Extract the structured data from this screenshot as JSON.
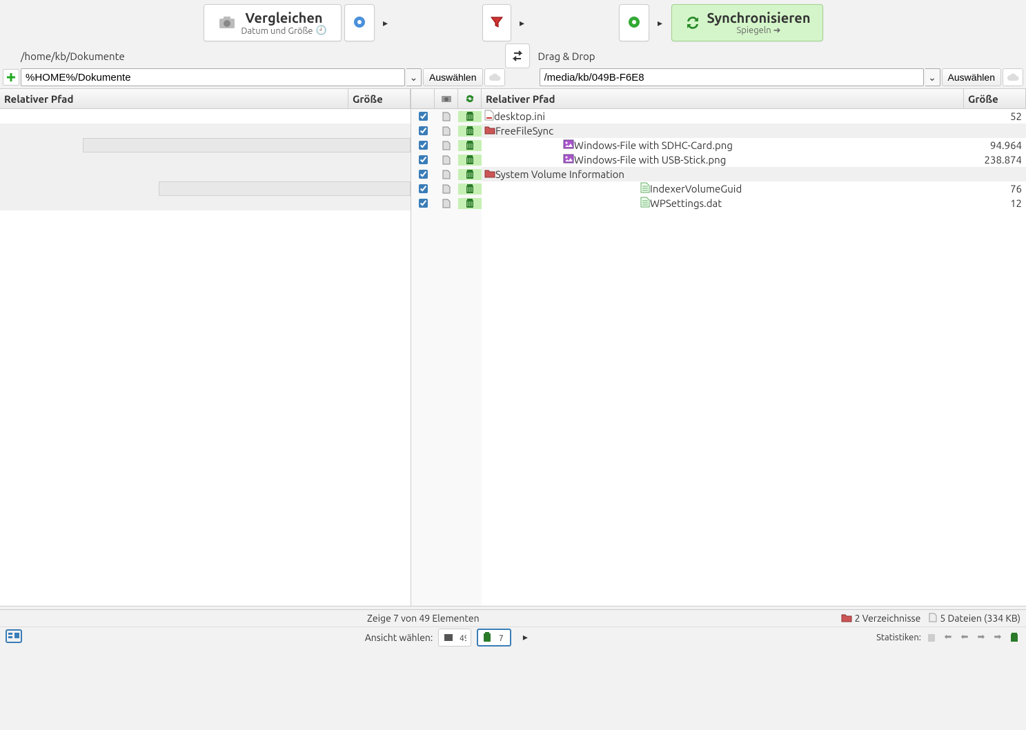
{
  "toolbar": {
    "compare": {
      "title": "Vergleichen",
      "subtitle": "Datum und Größe"
    },
    "sync": {
      "title": "Synchronisieren",
      "subtitle": "Spiegeln ➜"
    }
  },
  "paths": {
    "left_display": "/home/kb/Dokumente",
    "right_display": "Drag & Drop",
    "left_input": "%HOME%/Dokumente",
    "right_input": "/media/kb/049B-F6E8",
    "select_label": "Auswählen"
  },
  "headers": {
    "rel_path": "Relativer Pfad",
    "size": "Größe"
  },
  "right_rows": [
    {
      "type": "file",
      "indent": 0,
      "name": "desktop.ini",
      "size": "52",
      "icon": "file"
    },
    {
      "type": "folder",
      "indent": 0,
      "name": "FreeFileSync",
      "size": "",
      "icon": "folder"
    },
    {
      "type": "file",
      "indent": 1,
      "name": "Windows-File with SDHC-Card.png",
      "size": "94.964",
      "icon": "image"
    },
    {
      "type": "file",
      "indent": 1,
      "name": "Windows-File with USB-Stick.png",
      "size": "238.874",
      "icon": "image"
    },
    {
      "type": "folder",
      "indent": 0,
      "name": "System Volume Information",
      "size": "",
      "icon": "folder"
    },
    {
      "type": "file",
      "indent": 2,
      "name": "IndexerVolumeGuid",
      "size": "76",
      "icon": "data"
    },
    {
      "type": "file",
      "indent": 2,
      "name": "WPSettings.dat",
      "size": "12",
      "icon": "data"
    }
  ],
  "mid_row_count": 7,
  "status": {
    "center": "Zeige 7 von 49 Elementen",
    "dirs": "2 Verzeichnisse",
    "files": "5 Dateien (334 KB)"
  },
  "footer": {
    "view_label": "Ansicht wählen:",
    "stats_label": "Statistiken:"
  }
}
